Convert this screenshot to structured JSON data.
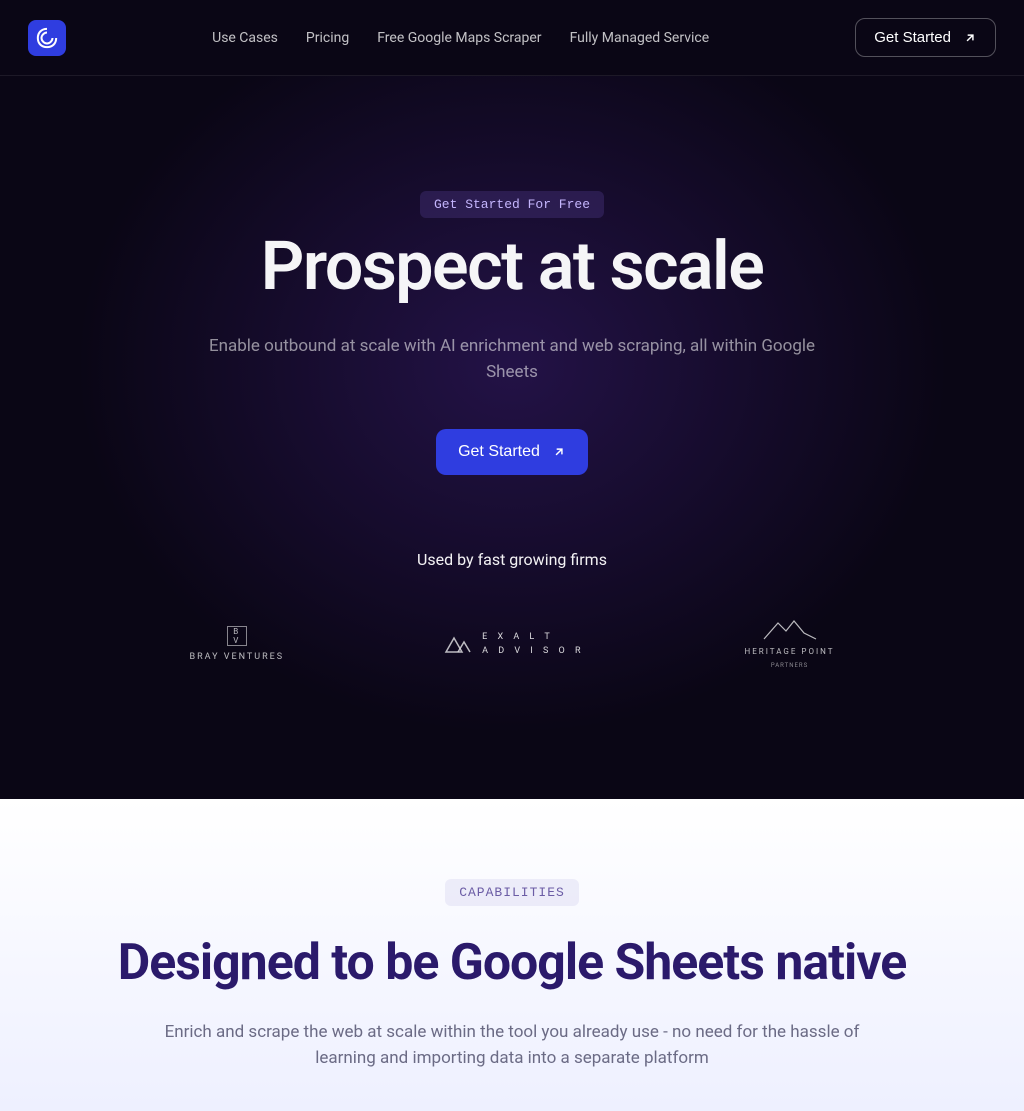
{
  "nav": {
    "items": [
      "Use Cases",
      "Pricing",
      "Free Google Maps Scraper",
      "Fully Managed Service"
    ]
  },
  "header": {
    "cta": "Get Started"
  },
  "hero": {
    "pill": "Get Started For Free",
    "title": "Prospect at scale",
    "subtitle": "Enable outbound at scale with AI enrichment and web scraping, all within Google Sheets",
    "cta": "Get Started"
  },
  "social": {
    "label": "Used by fast growing firms",
    "firms": [
      "BRAY VENTURES",
      "EXALT ADVISOR",
      "HERITAGE POINT"
    ]
  },
  "capabilities": {
    "tag": "CAPABILITIES",
    "title": "Designed to be Google Sheets native",
    "subtitle": "Enrich and scrape the web at scale within the tool you already use - no need for the hassle of learning and importing data into a separate platform"
  }
}
